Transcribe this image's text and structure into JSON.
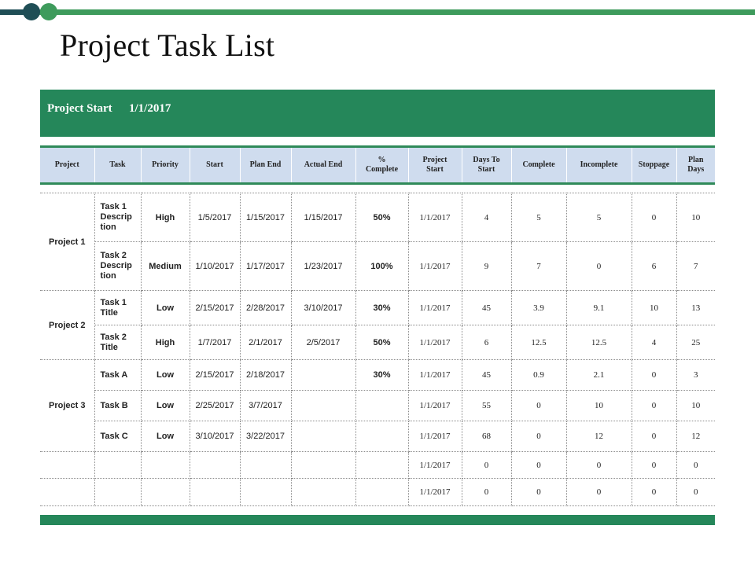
{
  "page": {
    "title": "Project Task List",
    "colors": {
      "accent_green": "#25875a",
      "dark_teal": "#1f4e56",
      "header_blue": "#cfdcee"
    }
  },
  "banner": {
    "label": "Project Start",
    "date": "1/1/2017"
  },
  "table": {
    "headers": [
      "Project",
      "Task",
      "Priority",
      "Start",
      "Plan End",
      "Actual End",
      "% Complete",
      "Project Start",
      "Days To Start",
      "Complete",
      "Incomplete",
      "Stoppage",
      "Plan Days"
    ],
    "groups": [
      {
        "project": "Project 1",
        "rows": [
          {
            "task": "Task 1 Description",
            "priority": "High",
            "start": "1/5/2017",
            "plan_end": "1/15/2017",
            "actual_end": "1/15/2017",
            "pct_complete": "50%",
            "project_start": "1/1/2017",
            "days_to_start": "4",
            "complete": "5",
            "incomplete": "5",
            "stoppage": "0",
            "plan_days": "10"
          },
          {
            "task": "Task 2 Description",
            "priority": "Medium",
            "start": "1/10/2017",
            "plan_end": "1/17/2017",
            "actual_end": "1/23/2017",
            "pct_complete": "100%",
            "project_start": "1/1/2017",
            "days_to_start": "9",
            "complete": "7",
            "incomplete": "0",
            "stoppage": "6",
            "plan_days": "7"
          }
        ]
      },
      {
        "project": "Project 2",
        "rows": [
          {
            "task": "Task 1 Title",
            "priority": "Low",
            "start": "2/15/2017",
            "plan_end": "2/28/2017",
            "actual_end": "3/10/2017",
            "pct_complete": "30%",
            "project_start": "1/1/2017",
            "days_to_start": "45",
            "complete": "3.9",
            "incomplete": "9.1",
            "stoppage": "10",
            "plan_days": "13"
          },
          {
            "task": "Task 2 Title",
            "priority": "High",
            "start": "1/7/2017",
            "plan_end": "2/1/2017",
            "actual_end": "2/5/2017",
            "pct_complete": "50%",
            "project_start": "1/1/2017",
            "days_to_start": "6",
            "complete": "12.5",
            "incomplete": "12.5",
            "stoppage": "4",
            "plan_days": "25"
          }
        ]
      },
      {
        "project": "Project 3",
        "rows": [
          {
            "task": "Task A",
            "priority": "Low",
            "start": "2/15/2017",
            "plan_end": "2/18/2017",
            "actual_end": "",
            "pct_complete": "30%",
            "project_start": "1/1/2017",
            "days_to_start": "45",
            "complete": "0.9",
            "incomplete": "2.1",
            "stoppage": "0",
            "plan_days": "3"
          },
          {
            "task": "Task B",
            "priority": "Low",
            "start": "2/25/2017",
            "plan_end": "3/7/2017",
            "actual_end": "",
            "pct_complete": "",
            "project_start": "1/1/2017",
            "days_to_start": "55",
            "complete": "0",
            "incomplete": "10",
            "stoppage": "0",
            "plan_days": "10"
          },
          {
            "task": "Task C",
            "priority": "Low",
            "start": "3/10/2017",
            "plan_end": "3/22/2017",
            "actual_end": "",
            "pct_complete": "",
            "project_start": "1/1/2017",
            "days_to_start": "68",
            "complete": "0",
            "incomplete": "12",
            "stoppage": "0",
            "plan_days": "12"
          }
        ]
      },
      {
        "project": "",
        "rows": [
          {
            "task": "",
            "priority": "",
            "start": "",
            "plan_end": "",
            "actual_end": "",
            "pct_complete": "",
            "project_start": "1/1/2017",
            "days_to_start": "0",
            "complete": "0",
            "incomplete": "0",
            "stoppage": "0",
            "plan_days": "0"
          }
        ]
      },
      {
        "project": "",
        "rows": [
          {
            "task": "",
            "priority": "",
            "start": "",
            "plan_end": "",
            "actual_end": "",
            "pct_complete": "",
            "project_start": "1/1/2017",
            "days_to_start": "0",
            "complete": "0",
            "incomplete": "0",
            "stoppage": "0",
            "plan_days": "0"
          }
        ]
      }
    ]
  }
}
